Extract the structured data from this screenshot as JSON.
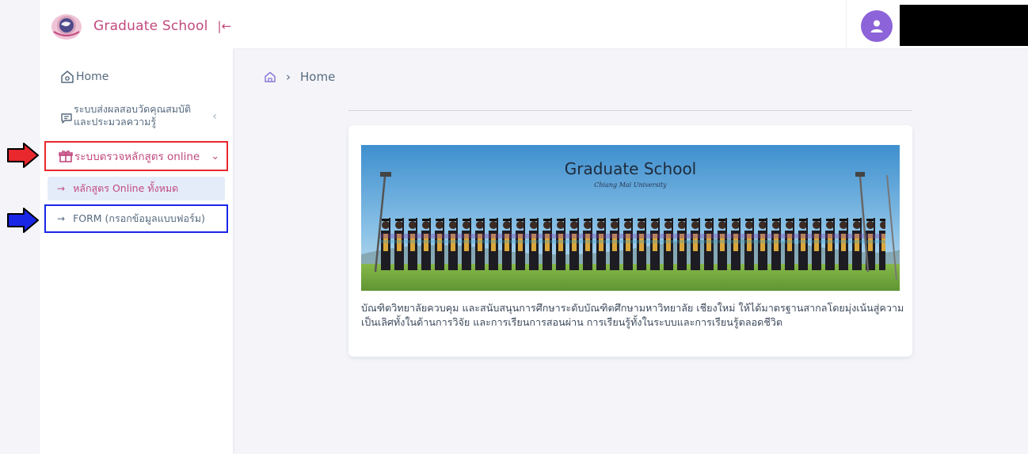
{
  "sidebar": {
    "brand": "Graduate School",
    "items": [
      {
        "label": "Home"
      },
      {
        "label": "ระบบส่งผลสอบวัดคุณสมบัติและประมวลความรู้"
      },
      {
        "label": "ระบบตรวจหลักสูตร online"
      }
    ],
    "submenu": [
      {
        "label": "หลักสูตร Online ทั้งหมด"
      },
      {
        "label": "FORM (กรอกข้อมูลแบบฟอร์ม)"
      }
    ]
  },
  "breadcrumb": {
    "current": "Home"
  },
  "banner": {
    "title": "Graduate School",
    "subtitle": "Chiang Mai University"
  },
  "description": "บัณฑิตวิทยาลัยควบคุม และสนับสนุนการศึกษาระดับบัณฑิตศึกษามหาวิทยาลัย เชียงใหม่ ให้ได้มาตรฐานสากลโดยมุ่งเน้นสู่ความเป็นเลิศทั้งในด้านการวิจัย และการเรียนการสอนผ่าน การเรียนรู้ทั้งในระบบและการเรียนรู้ตลอดชีวิต",
  "colors": {
    "brand": "#c14a7f",
    "avatar": "#8c63d8",
    "highlight_red": "#e8282d",
    "highlight_blue": "#1a26e6",
    "active_bg": "#e4ecfa"
  },
  "icons": [
    "logo-icon",
    "collapse-icon",
    "home-icon",
    "message-icon",
    "gift-icon",
    "chevron-left-icon",
    "chevron-down-icon",
    "arrow-right-icon",
    "user-icon"
  ]
}
